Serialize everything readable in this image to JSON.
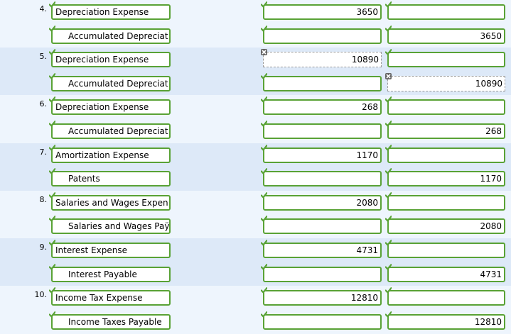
{
  "entries": [
    {
      "number": "4.",
      "debit_account": "Depreciation Expense",
      "credit_account": "Accumulated Depreciat",
      "debit_amount": "3650",
      "credit_amount": "3650",
      "marks": [
        "check",
        "check",
        "check",
        "check",
        "check",
        "check"
      ]
    },
    {
      "number": "5.",
      "debit_account": "Depreciation Expense",
      "credit_account": "Accumulated Depreciat",
      "debit_amount": "10890",
      "credit_amount": "10890",
      "marks": [
        "check",
        "cross",
        "check",
        "check",
        "check",
        "cross"
      ]
    },
    {
      "number": "6.",
      "debit_account": "Depreciation Expense",
      "credit_account": "Accumulated Depreciat",
      "debit_amount": "268",
      "credit_amount": "268",
      "marks": [
        "check",
        "check",
        "check",
        "check",
        "check",
        "check"
      ]
    },
    {
      "number": "7.",
      "debit_account": "Amortization Expense",
      "credit_account": "Patents",
      "debit_amount": "1170",
      "credit_amount": "1170",
      "marks": [
        "check",
        "check",
        "check",
        "check",
        "check",
        "check"
      ]
    },
    {
      "number": "8.",
      "debit_account": "Salaries and Wages Expen",
      "credit_account": "Salaries and Wages Paÿ",
      "debit_amount": "2080",
      "credit_amount": "2080",
      "marks": [
        "check",
        "check",
        "check",
        "check",
        "check",
        "check"
      ]
    },
    {
      "number": "9.",
      "debit_account": "Interest Expense",
      "credit_account": "Interest Payable",
      "debit_amount": "4731",
      "credit_amount": "4731",
      "marks": [
        "check",
        "check",
        "check",
        "check",
        "check",
        "check"
      ]
    },
    {
      "number": "10.",
      "debit_account": "Income Tax Expense",
      "credit_account": "Income Taxes Payable",
      "debit_amount": "12810",
      "credit_amount": "12810",
      "marks": [
        "check",
        "check",
        "check",
        "check",
        "check",
        "check"
      ]
    }
  ],
  "colors": {
    "correct": "#59a235",
    "incorrect": "#666666",
    "band_light": "#eef5fd",
    "band_dark": "#dde9f8"
  }
}
